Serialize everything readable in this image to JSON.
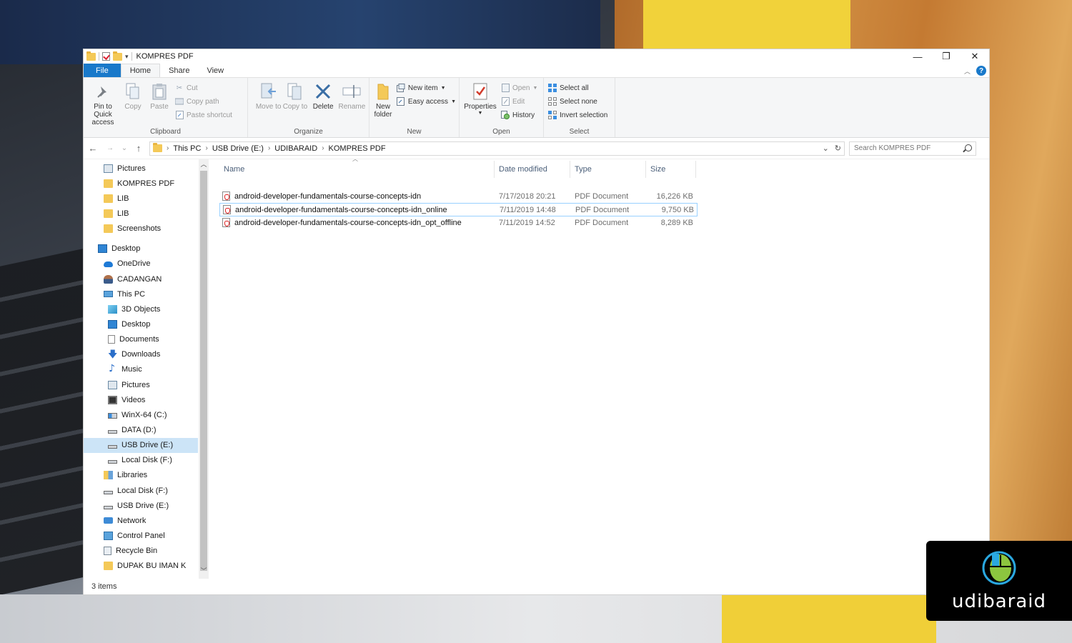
{
  "window": {
    "title": "KOMPRES PDF",
    "controls": [
      "—",
      "❐",
      "✕"
    ]
  },
  "ribbon_tabs": [
    "File",
    "Home",
    "Share",
    "View"
  ],
  "ribbon": {
    "clipboard": {
      "label": "Clipboard",
      "pin": "Pin to Quick access",
      "copy": "Copy",
      "paste": "Paste",
      "cut": "Cut",
      "copy_path": "Copy path",
      "paste_shortcut": "Paste shortcut"
    },
    "organize": {
      "label": "Organize",
      "move_to": "Move to",
      "copy_to": "Copy to",
      "delete": "Delete",
      "rename": "Rename"
    },
    "new": {
      "label": "New",
      "new_folder": "New folder",
      "new_item": "New item",
      "easy_access": "Easy access"
    },
    "open": {
      "label": "Open",
      "properties": "Properties",
      "open": "Open",
      "edit": "Edit",
      "history": "History"
    },
    "select": {
      "label": "Select",
      "select_all": "Select all",
      "select_none": "Select none",
      "invert": "Invert selection"
    }
  },
  "address": {
    "crumbs": [
      "This PC",
      "USB Drive (E:)",
      "UDIBARAID",
      "KOMPRES PDF"
    ],
    "search_placeholder": "Search KOMPRES PDF"
  },
  "nav": {
    "items": [
      {
        "label": "Pictures",
        "icon": "pictures-icon"
      },
      {
        "label": "KOMPRES PDF",
        "icon": "folder-icon"
      },
      {
        "label": "LIB",
        "icon": "folder-icon"
      },
      {
        "label": "LIB",
        "icon": "folder-icon"
      },
      {
        "label": "Screenshots",
        "icon": "folder-icon"
      },
      {
        "label": "Desktop",
        "icon": "desktop-icon"
      },
      {
        "label": "OneDrive",
        "icon": "onedrive-icon"
      },
      {
        "label": "CADANGAN",
        "icon": "user-icon"
      },
      {
        "label": "This PC",
        "icon": "this-pc-icon"
      },
      {
        "label": "3D Objects",
        "icon": "3d-objects-icon"
      },
      {
        "label": "Desktop",
        "icon": "desktop-icon"
      },
      {
        "label": "Documents",
        "icon": "documents-icon"
      },
      {
        "label": "Downloads",
        "icon": "downloads-icon"
      },
      {
        "label": "Music",
        "icon": "music-icon"
      },
      {
        "label": "Pictures",
        "icon": "pictures-icon"
      },
      {
        "label": "Videos",
        "icon": "videos-icon"
      },
      {
        "label": "WinX-64 (C:)",
        "icon": "windows-drive-icon"
      },
      {
        "label": "DATA (D:)",
        "icon": "drive-icon"
      },
      {
        "label": "USB Drive (E:)",
        "icon": "drive-icon"
      },
      {
        "label": "Local Disk (F:)",
        "icon": "drive-icon"
      },
      {
        "label": "Libraries",
        "icon": "libraries-icon"
      },
      {
        "label": "Local Disk (F:)",
        "icon": "drive-icon"
      },
      {
        "label": "USB Drive (E:)",
        "icon": "drive-icon"
      },
      {
        "label": "Network",
        "icon": "network-icon"
      },
      {
        "label": "Control Panel",
        "icon": "control-panel-icon"
      },
      {
        "label": "Recycle Bin",
        "icon": "recycle-bin-icon"
      },
      {
        "label": "DUPAK BU IMAN K",
        "icon": "folder-icon"
      }
    ],
    "selected": "USB Drive (E:)"
  },
  "columns": [
    "Name",
    "Date modified",
    "Type",
    "Size"
  ],
  "files": [
    {
      "name": "android-developer-fundamentals-course-concepts-idn",
      "date": "7/17/2018 20:21",
      "type": "PDF Document",
      "size": "16,226 KB"
    },
    {
      "name": "android-developer-fundamentals-course-concepts-idn_online",
      "date": "7/11/2019 14:48",
      "type": "PDF Document",
      "size": "9,750 KB"
    },
    {
      "name": "android-developer-fundamentals-course-concepts-idn_opt_offline",
      "date": "7/11/2019 14:52",
      "type": "PDF Document",
      "size": "8,289 KB"
    }
  ],
  "status": {
    "item_count": "3 items"
  },
  "watermark": {
    "text": "udibaraid"
  },
  "colors": {
    "accent": "#1979ca",
    "selection": "#cce4f7",
    "logo_green": "#8cc63f",
    "logo_blue": "#2aa8e0"
  }
}
